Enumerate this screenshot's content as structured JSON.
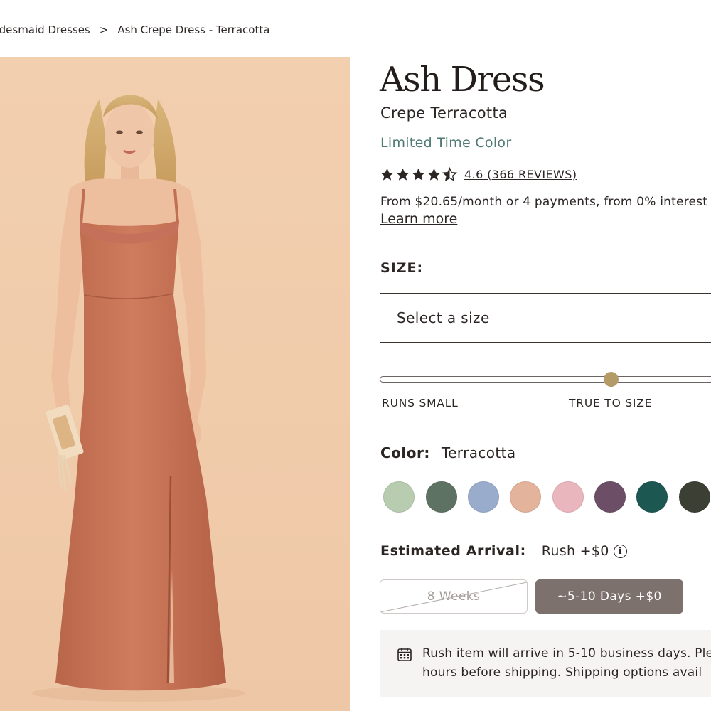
{
  "breadcrumb": {
    "items": [
      "Bridesmaid Dresses",
      "Ash Crepe Dress - Terracotta"
    ],
    "separator": ">"
  },
  "product": {
    "name": "Ash Dress",
    "fabric_color": "Crepe Terracotta",
    "badge": "Limited Time Color",
    "rating_value": 4.6,
    "reviews_text": "4.6 (366 REVIEWS)",
    "financing_text": "From $20.65/month or 4 payments, from 0% interest",
    "learn_more": "Learn more"
  },
  "size": {
    "label": "SIZE:",
    "placeholder": "Select a size"
  },
  "fit": {
    "level": "true to size",
    "labels": [
      "RUNS SMALL",
      "TRUE TO SIZE"
    ]
  },
  "color": {
    "label": "Color:",
    "selected": "Terracotta",
    "swatches": [
      {
        "color": "#b8ccb0"
      },
      {
        "color": "#5d7262"
      },
      {
        "color": "#9aaccc"
      },
      {
        "color": "#e4b39b"
      },
      {
        "color": "#eab6bd"
      },
      {
        "color": "#6c4f66"
      },
      {
        "color": "#1c5752"
      },
      {
        "color": "#3c4034"
      }
    ]
  },
  "arrival": {
    "label": "Estimated Arrival:",
    "value": "Rush +$0",
    "info_icon": "info-icon",
    "options": [
      {
        "label": "8 Weeks",
        "state": "unavailable"
      },
      {
        "label": "~5-10 Days +$0",
        "state": "selected"
      }
    ]
  },
  "notice": {
    "icon": "calendar-icon",
    "line1": "Rush item will arrive in 5-10 business days. Ple",
    "line2": "hours before shipping. Shipping options avail"
  },
  "colors": {
    "accent_teal": "#4f7a74",
    "fit_thumb": "#b39a67",
    "selected_button": "#7d716e",
    "hero_background": "#f0cbaa"
  }
}
